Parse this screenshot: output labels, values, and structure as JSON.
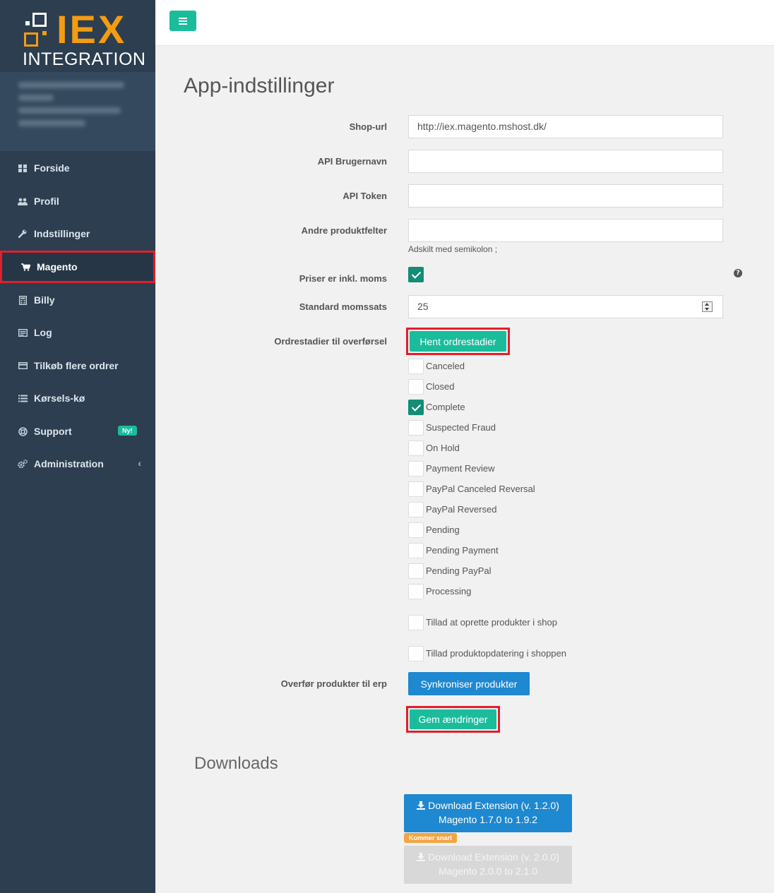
{
  "logo": {
    "main": "IEX",
    "sub": "INTEGRATION"
  },
  "sidebar": {
    "items": [
      {
        "label": "Forside",
        "icon": "dashboard-icon"
      },
      {
        "label": "Profil",
        "icon": "users-icon"
      },
      {
        "label": "Indstillinger",
        "icon": "wrench-icon"
      },
      {
        "label": "Magento",
        "icon": "cart-icon",
        "active": true
      },
      {
        "label": "Billy",
        "icon": "calculator-icon"
      },
      {
        "label": "Log",
        "icon": "log-icon"
      },
      {
        "label": "Tilkøb flere ordrer",
        "icon": "credit-card-icon"
      },
      {
        "label": "Kørsels-kø",
        "icon": "list-icon"
      },
      {
        "label": "Support",
        "icon": "lifebuoy-icon",
        "badge": "Ny!"
      },
      {
        "label": "Administration",
        "icon": "cogs-icon",
        "chevron": "‹"
      }
    ]
  },
  "page": {
    "title": "App-indstillinger"
  },
  "form": {
    "shop_url": {
      "label": "Shop-url",
      "value": "http://iex.magento.mshost.dk/"
    },
    "api_user": {
      "label": "API Brugernavn",
      "value": ""
    },
    "api_token": {
      "label": "API Token",
      "value": ""
    },
    "other_fields": {
      "label": "Andre produktfelter",
      "value": "",
      "help": "Adskilt med semikolon ;"
    },
    "vat_incl": {
      "label": "Priser er inkl. moms",
      "checked": true,
      "help_icon": "?"
    },
    "vat_rate": {
      "label": "Standard momssats",
      "value": "25"
    },
    "order_states": {
      "label": "Ordrestadier til overførsel",
      "fetch_button": "Hent ordrestadier",
      "options": [
        {
          "label": "Canceled",
          "checked": false
        },
        {
          "label": "Closed",
          "checked": false
        },
        {
          "label": "Complete",
          "checked": true
        },
        {
          "label": "Suspected Fraud",
          "checked": false
        },
        {
          "label": "On Hold",
          "checked": false
        },
        {
          "label": "Payment Review",
          "checked": false
        },
        {
          "label": "PayPal Canceled Reversal",
          "checked": false
        },
        {
          "label": "PayPal Reversed",
          "checked": false
        },
        {
          "label": "Pending",
          "checked": false
        },
        {
          "label": "Pending Payment",
          "checked": false
        },
        {
          "label": "Pending PayPal",
          "checked": false
        },
        {
          "label": "Processing",
          "checked": false
        }
      ]
    },
    "allow_create": {
      "label": "Tillad at oprette produkter i shop",
      "checked": false
    },
    "allow_update": {
      "label": "Tillad produktopdatering i shoppen",
      "checked": false
    },
    "transfer": {
      "label": "Overfør produkter til erp",
      "button": "Synkroniser produkter"
    },
    "save_button": "Gem ændringer"
  },
  "downloads": {
    "title": "Downloads",
    "ext1": {
      "line1": "Download Extension (v. 1.2.0)",
      "line2": "Magento 1.7.0 to 1.9.2"
    },
    "soon_badge": "Kommer snart",
    "ext2": {
      "line1": "Download Extension (v. 2.0.0)",
      "line2": "Magento 2.0.0 to 2.1.0"
    }
  },
  "colors": {
    "sidebar": "#2c3e50",
    "accent": "#1abc9c",
    "primary": "#1e88d0",
    "logo": "#f39c12",
    "highlight": "#e0202a"
  }
}
